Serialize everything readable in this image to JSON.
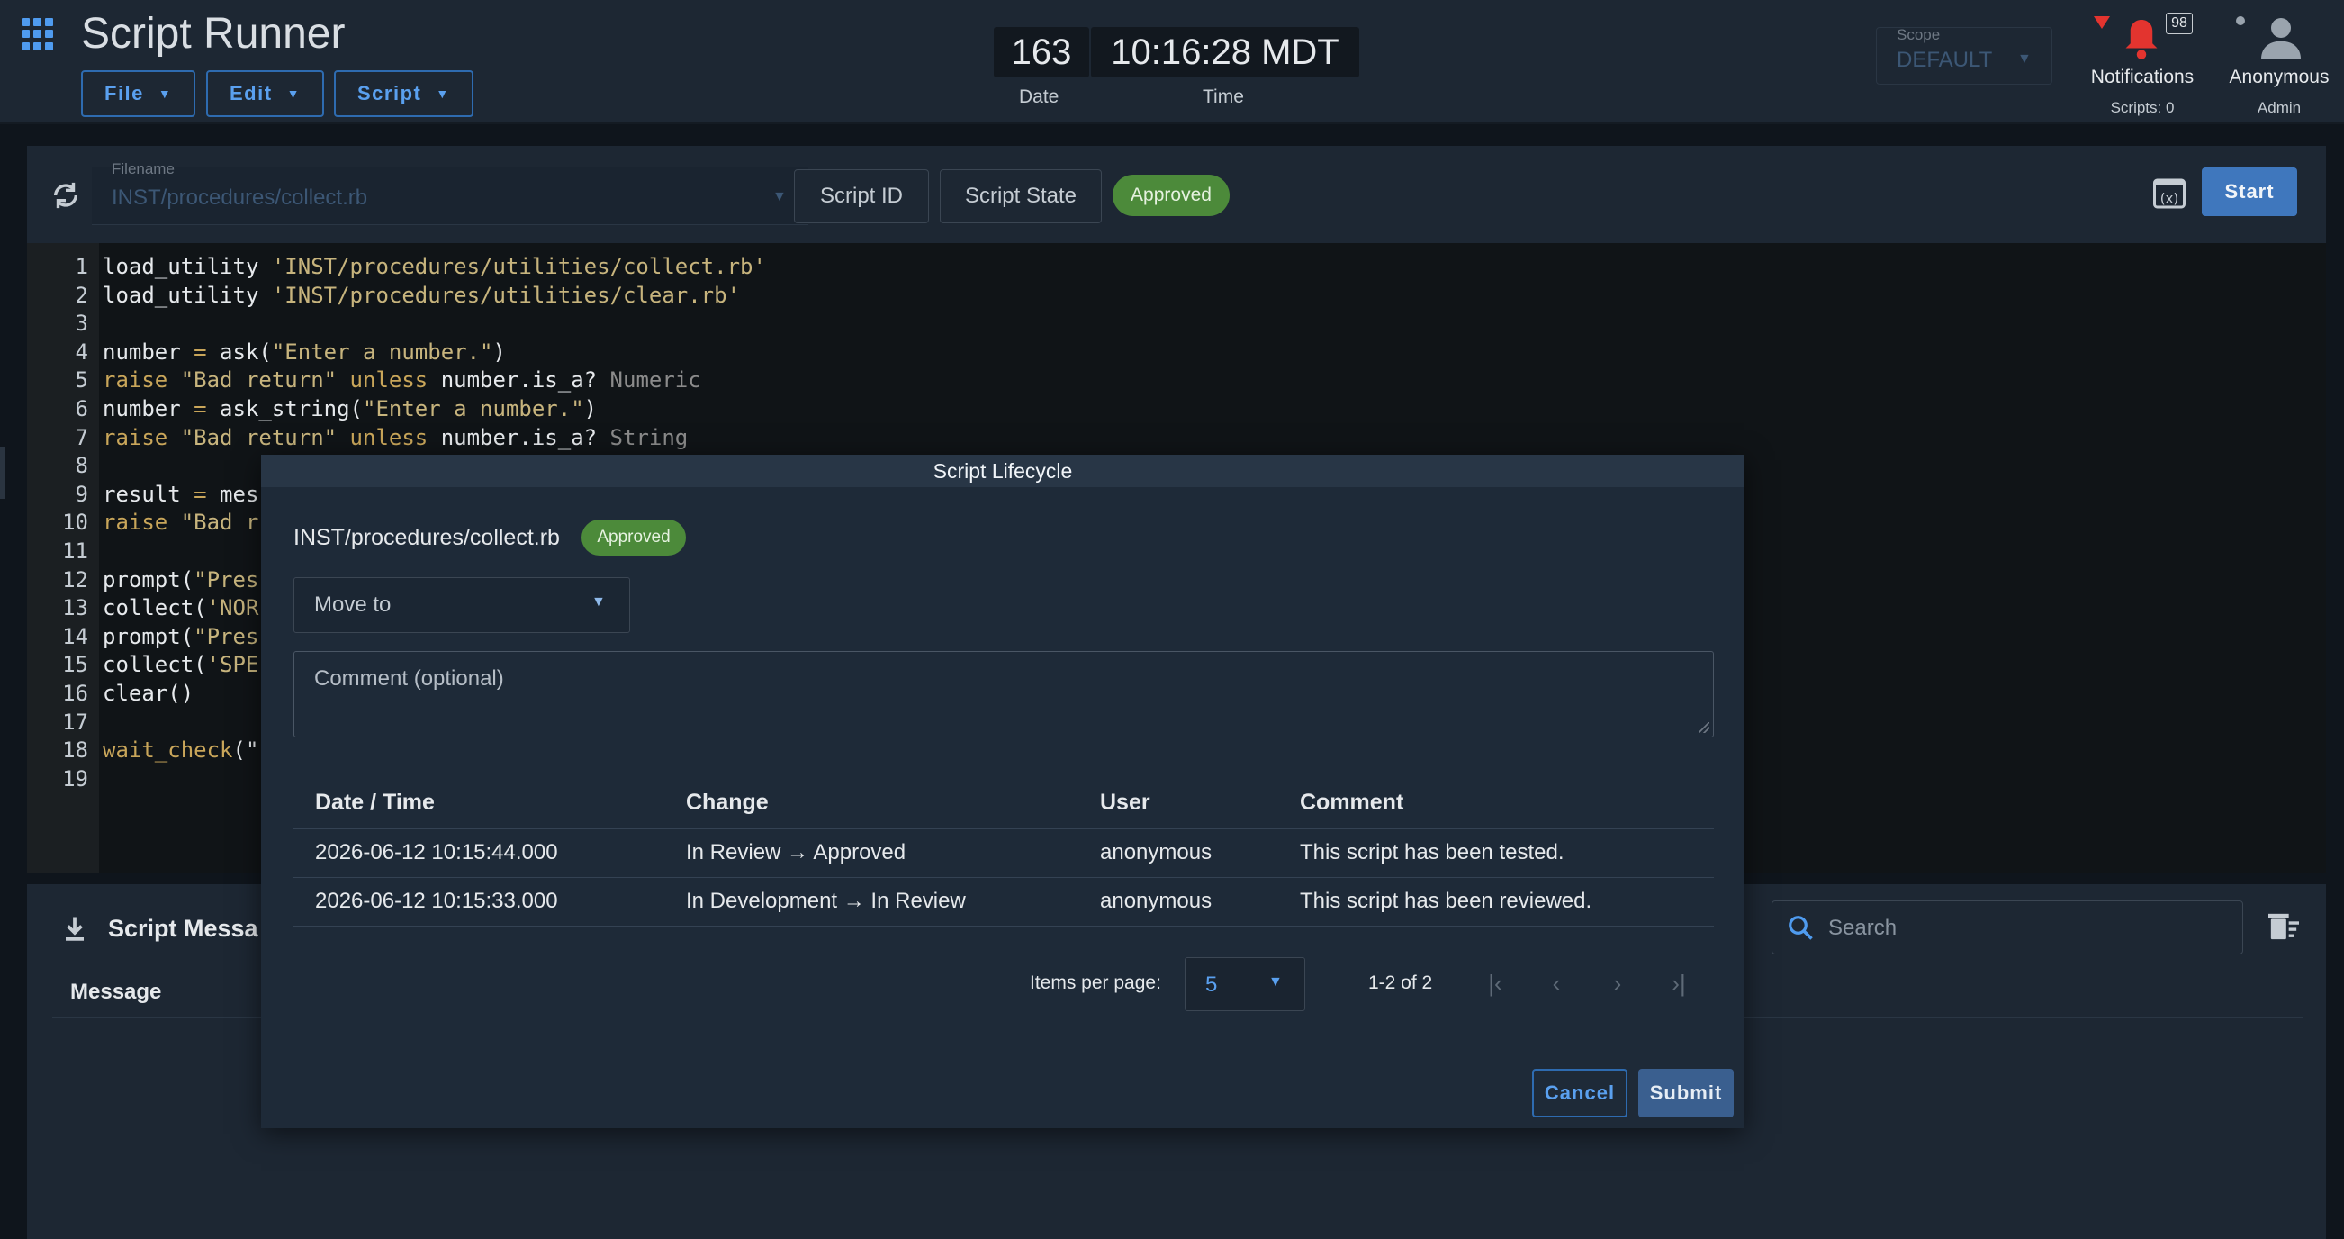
{
  "app": {
    "title": "Script Runner"
  },
  "menus": {
    "file": "File",
    "edit": "Edit",
    "script": "Script"
  },
  "clock": {
    "date_value": "163",
    "date_label": "Date",
    "time_value": "10:16:28 MDT",
    "time_label": "Time"
  },
  "scope": {
    "label": "Scope",
    "value": "DEFAULT"
  },
  "notifications": {
    "label": "Notifications",
    "count": "98",
    "sub": "Scripts: 0"
  },
  "user": {
    "name": "Anonymous",
    "role": "Admin"
  },
  "toolbar": {
    "filename_label": "Filename",
    "filename_value": "INST/procedures/collect.rb",
    "script_id_label": "Script ID",
    "script_state_label": "Script State",
    "state_chip": "Approved",
    "start_label": "Start"
  },
  "editor": {
    "line_numbers": [
      "1",
      "2",
      "3",
      "4",
      "5",
      "6",
      "7",
      "8",
      "9",
      "10",
      "11",
      "12",
      "13",
      "14",
      "15",
      "16",
      "17",
      "18",
      "19"
    ],
    "lines": [
      {
        "n": "1",
        "parts": [
          [
            "",
            "load_utility "
          ],
          [
            "str",
            "'INST/procedures/utilities/collect.rb'"
          ]
        ]
      },
      {
        "n": "2",
        "parts": [
          [
            "",
            "load_utility "
          ],
          [
            "str",
            "'INST/procedures/utilities/clear.rb'"
          ]
        ]
      },
      {
        "n": "3",
        "parts": []
      },
      {
        "n": "4",
        "parts": [
          [
            "",
            "number "
          ],
          [
            "kw",
            "="
          ],
          [
            "",
            " ask("
          ],
          [
            "str",
            "\"Enter a number.\""
          ],
          [
            "",
            ")"
          ]
        ]
      },
      {
        "n": "5",
        "parts": [
          [
            "kw",
            "raise"
          ],
          [
            "",
            " "
          ],
          [
            "str",
            "\"Bad return\""
          ],
          [
            "",
            " "
          ],
          [
            "kw",
            "unless"
          ],
          [
            "",
            " number.is_a? "
          ],
          [
            "const",
            "Numeric"
          ]
        ]
      },
      {
        "n": "6",
        "parts": [
          [
            "",
            "number "
          ],
          [
            "kw",
            "="
          ],
          [
            "",
            " ask_string("
          ],
          [
            "str",
            "\"Enter a number.\""
          ],
          [
            "",
            ")"
          ]
        ]
      },
      {
        "n": "7",
        "parts": [
          [
            "kw",
            "raise"
          ],
          [
            "",
            " "
          ],
          [
            "str",
            "\"Bad return\""
          ],
          [
            "",
            " "
          ],
          [
            "kw",
            "unless"
          ],
          [
            "",
            " number.is_a? "
          ],
          [
            "const",
            "String"
          ]
        ]
      },
      {
        "n": "8",
        "parts": []
      },
      {
        "n": "9",
        "parts": [
          [
            "",
            "result "
          ],
          [
            "kw",
            "="
          ],
          [
            "",
            " mes"
          ]
        ]
      },
      {
        "n": "10",
        "parts": [
          [
            "kw",
            "raise"
          ],
          [
            "",
            " "
          ],
          [
            "str",
            "\"Bad r"
          ]
        ]
      },
      {
        "n": "11",
        "parts": []
      },
      {
        "n": "12",
        "parts": [
          [
            "",
            "prompt("
          ],
          [
            "str",
            "\"Pres"
          ]
        ]
      },
      {
        "n": "13",
        "parts": [
          [
            "",
            "collect("
          ],
          [
            "str",
            "'NOR"
          ]
        ]
      },
      {
        "n": "14",
        "parts": [
          [
            "",
            "prompt("
          ],
          [
            "str",
            "\"Pres"
          ]
        ]
      },
      {
        "n": "15",
        "parts": [
          [
            "",
            "collect("
          ],
          [
            "str",
            "'SPE"
          ]
        ]
      },
      {
        "n": "16",
        "parts": [
          [
            "",
            "clear()"
          ]
        ]
      },
      {
        "n": "17",
        "parts": []
      },
      {
        "n": "18",
        "parts": [
          [
            "kw",
            "wait_check"
          ],
          [
            "",
            "(\""
          ]
        ]
      },
      {
        "n": "19",
        "parts": []
      }
    ]
  },
  "messages": {
    "title": "Script Messa",
    "search_placeholder": "Search",
    "column_message": "Message"
  },
  "dialog": {
    "title": "Script Lifecycle",
    "filename": "INST/procedures/collect.rb",
    "state_chip": "Approved",
    "move_to_label": "Move to",
    "comment_placeholder": "Comment (optional)",
    "table": {
      "headers": [
        "Date / Time",
        "Change",
        "User",
        "Comment"
      ],
      "rows": [
        [
          "2026-06-12 10:15:44.000",
          "In Review → Approved",
          "anonymous",
          "This script has been tested."
        ],
        [
          "2026-06-12 10:15:33.000",
          "In Development → In Review",
          "anonymous",
          "This script has been reviewed."
        ]
      ]
    },
    "pager": {
      "items_per_page_label": "Items per page:",
      "items_per_page": "5",
      "range": "1-2 of 2"
    },
    "cancel_label": "Cancel",
    "submit_label": "Submit"
  },
  "colors": {
    "accent": "#4f9bef",
    "approved": "#4c8a3a",
    "alert": "#e3342f",
    "panel": "#1d2733",
    "dialog": "#1e2a38"
  }
}
